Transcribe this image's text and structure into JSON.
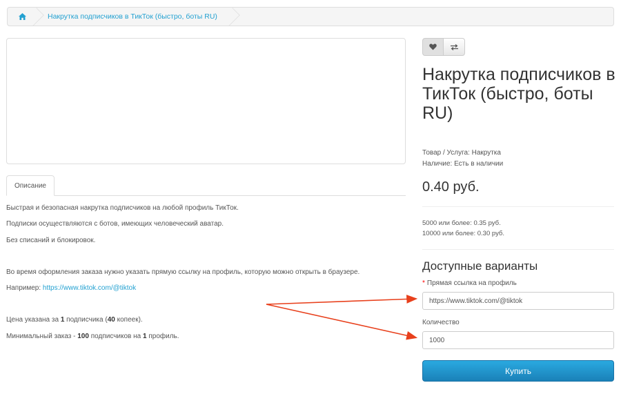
{
  "breadcrumb": {
    "home_icon": "home-icon",
    "current": "Накрутка подписчиков в ТикТок (быстро, боты RU)"
  },
  "tabs": [
    {
      "label": "Описание"
    }
  ],
  "description": {
    "line1": "Быстрая и безопасная накрутка подписчиков на любой профиль ТикТок.",
    "line2": "Подписки осуществляются с ботов, имеющих человеческий аватар.",
    "line3": "Без списаний и блокировок.",
    "line4": "Во время оформления заказа нужно указать прямую ссылку на профиль, которую можно открыть в браузере.",
    "example_label": "Например: ",
    "example_link": "https://www.tiktok.com/@tiktok",
    "price_prefix": "Цена указана за ",
    "price_qty": "1",
    "price_mid": " подписчика (",
    "price_kopeks": "40",
    "price_suffix": " копеек).",
    "min_prefix": "Минимальный заказ - ",
    "min_qty": "100",
    "min_mid": " подписчиков на ",
    "min_profiles": "1",
    "min_suffix": " профиль."
  },
  "actions": {
    "wishlist_icon": "heart-icon",
    "compare_icon": "compare-arrows-icon"
  },
  "product": {
    "title": "Накрутка подписчиков в ТикТок (быстро, боты RU)",
    "category": "Товар / Услуга: Накрутка",
    "availability": "Наличие: Есть в наличии",
    "price": "0.40 руб.",
    "discounts": [
      "5000 или более: 0.35 руб.",
      "10000 или более: 0.30 руб."
    ]
  },
  "options": {
    "title": "Доступные варианты",
    "link_required_mark": "*",
    "link_label": "Прямая ссылка на профиль",
    "link_value": "https://www.tiktok.com/@tiktok",
    "quantity_label": "Количество",
    "quantity_value": "1000"
  },
  "buy_button": "Купить",
  "colors": {
    "link": "#23a1d1",
    "button": "#1f8fcc",
    "arrow": "#e8401c"
  }
}
